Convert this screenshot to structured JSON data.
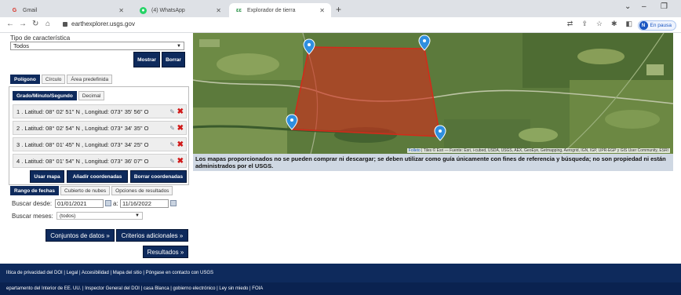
{
  "browser": {
    "tabs": [
      {
        "icon": "gmail-icon",
        "label": "Gmail"
      },
      {
        "icon": "whatsapp-icon",
        "label": "(4) WhatsApp"
      },
      {
        "icon": "earthexplorer-icon",
        "label": "Explorador de tierra"
      }
    ],
    "url": "earthexplorer.usgs.gov",
    "profile_initial": "N",
    "profile_status": "En pausa"
  },
  "search": {
    "feature_type_label": "Tipo de característica",
    "feature_type_value": "Todos",
    "show_button": "Mostrar",
    "clear_button": "Borrar"
  },
  "shape_tabs": [
    "Polígono",
    "Círculo",
    "Área predefinida"
  ],
  "format_tabs": [
    "Grado/Minuto/Segundo",
    "Decimal"
  ],
  "coordinates": [
    "1 .  Latitud: 08° 02' 51\" N , Longitud: 073° 35' 56\" O",
    "2 .  Latitud: 08° 02' 54\" N , Longitud: 073° 34' 35\" O",
    "3 .  Latitud: 08° 01' 45\" N , Longitud: 073° 34' 25\" O",
    "4 .  Latitud: 08° 01' 54\" N , Longitud: 073° 36' 07\" O"
  ],
  "coord_buttons": [
    "Usar mapa",
    "Añadir coordenadas",
    "Borrar coordenadas"
  ],
  "date_tabs": [
    "Rango de fechas",
    "Cubierto de nubes",
    "Opciones de resultados"
  ],
  "dates": {
    "search_from_label": "Buscar desde:",
    "from": "01/01/2021",
    "to_label": "a:",
    "to": "11/16/2022",
    "months_label": "Buscar meses:",
    "months_value": "(todos)"
  },
  "nav_buttons": {
    "datasets": "Conjuntos de datos »",
    "criteria": "Criterios adicionales »",
    "results": "Resultados »"
  },
  "map": {
    "attribution_link": "Folleto",
    "attribution_text": " | Tiles © Esri — Fuente: Esri, i-cubed, USDA, USGS, AEX, GeoEye, Getmapping, Aerogrid, IGN, IGP, UPR-EGP y GIS User Community, ESRI",
    "disclaimer": "Los mapas proporcionados no se pueden comprar ni descargar; se deben utilizar como guía únicamente con fines de referencia y búsqueda; no son propiedad ni están administrados por el USGS."
  },
  "footer": {
    "line1": "lítica de privacidad del DOI  |  Legal  |  Accesibilidad  |  Mapa del sitio  |  Póngase en contacto con USGS",
    "line2": "epartamento del Interior de EE. UU.  |  Inspector General del DOI  |  casa Blanca  |  gobierno electrónico  |  Ley sin miedo  |  FOIA"
  },
  "colors": {
    "navy": "#0e2a5c",
    "polygon": "#d42a1a",
    "marker": "#2f8fe0"
  }
}
